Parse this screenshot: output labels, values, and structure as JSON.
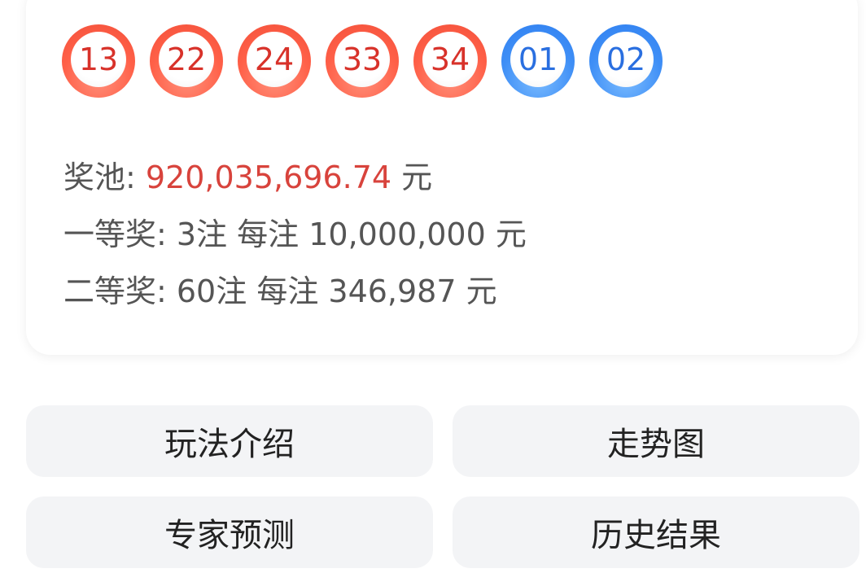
{
  "balls": {
    "red": [
      "13",
      "22",
      "24",
      "33",
      "34"
    ],
    "blue": [
      "01",
      "02"
    ]
  },
  "prize_info": {
    "pool_label": "奖池: ",
    "pool_amount": "920,035,696.74",
    "pool_unit": " 元",
    "first_prize": "一等奖: 3注 每注 10,000,000 元",
    "second_prize": "二等奖: 60注 每注 346,987 元"
  },
  "actions": {
    "rules": "玩法介绍",
    "trend": "走势图",
    "expert": "专家预测",
    "history": "历史结果"
  },
  "colors": {
    "red_ball": "#ff6048",
    "blue_ball": "#3f8ff6",
    "pool_amount": "#d8433c",
    "button_bg": "#f3f4f6"
  }
}
